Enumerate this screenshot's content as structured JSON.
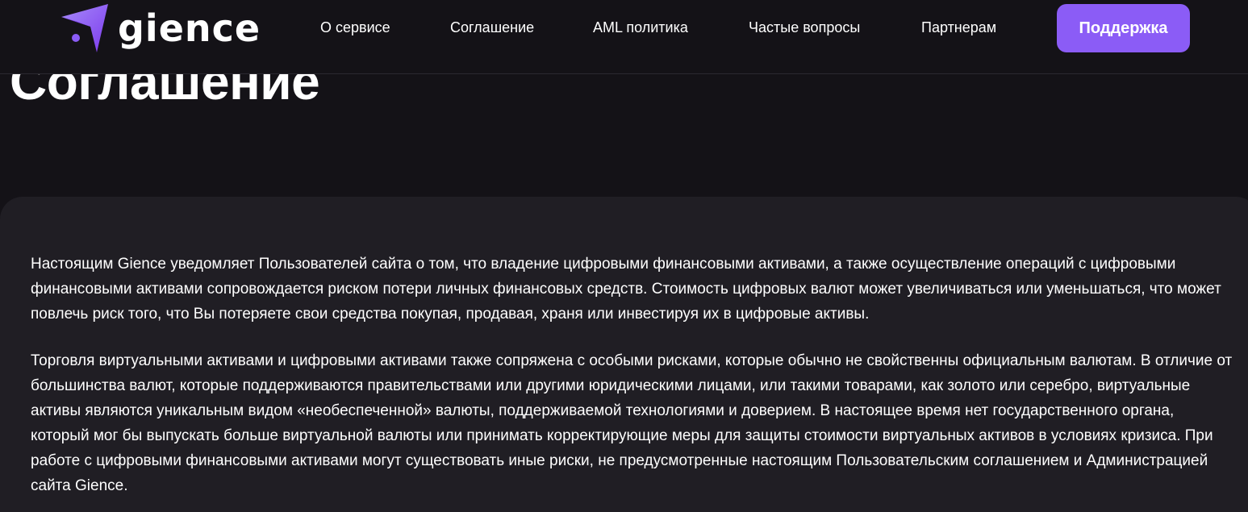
{
  "header": {
    "logo_text": "gience",
    "nav": [
      {
        "label": "О сервисе"
      },
      {
        "label": "Соглашение"
      },
      {
        "label": "AML политика"
      },
      {
        "label": "Частые вопросы"
      },
      {
        "label": "Партнерам"
      }
    ],
    "support_label": "Поддержка"
  },
  "page": {
    "title": "Соглашение"
  },
  "content": {
    "paragraphs": [
      "Настоящим Gience уведомляет Пользователей сайта о том, что владение цифровыми финансовыми активами, а также осуществление операций с цифровыми финансовыми активами сопровождается риском потери личных финансовых средств. Стоимость цифровых валют может увеличиваться или уменьшаться, что может повлечь риск того, что Вы потеряете свои средства покупая, продавая, храня или инвестируя их в цифровые активы.",
      "Торговля виртуальными активами и цифровыми активами также сопряжена с особыми рисками, которые обычно не свойственны официальным валютам. В отличие от большинства валют, которые поддерживаются правительствами или другими юридическими лицами, или такими товарами, как золото или серебро, виртуальные активы являются уникальным видом «необеспеченной» валюты, поддерживаемой технологиями и доверием. В настоящее время нет государственного органа, который мог бы выпускать больше виртуальной валюты или принимать корректирующие меры для защиты стоимости виртуальных активов в условиях кризиса. При работе с цифровыми финансовыми активами могут существовать иные риски, не предусмотренные настоящим Пользовательским соглашением и Администрацией сайта Gience."
    ]
  },
  "colors": {
    "background": "#141217",
    "card": "#201e24",
    "accent": "#8b5cf6",
    "text": "#ffffff"
  },
  "icons": {
    "logo": "gience-logo-icon"
  }
}
